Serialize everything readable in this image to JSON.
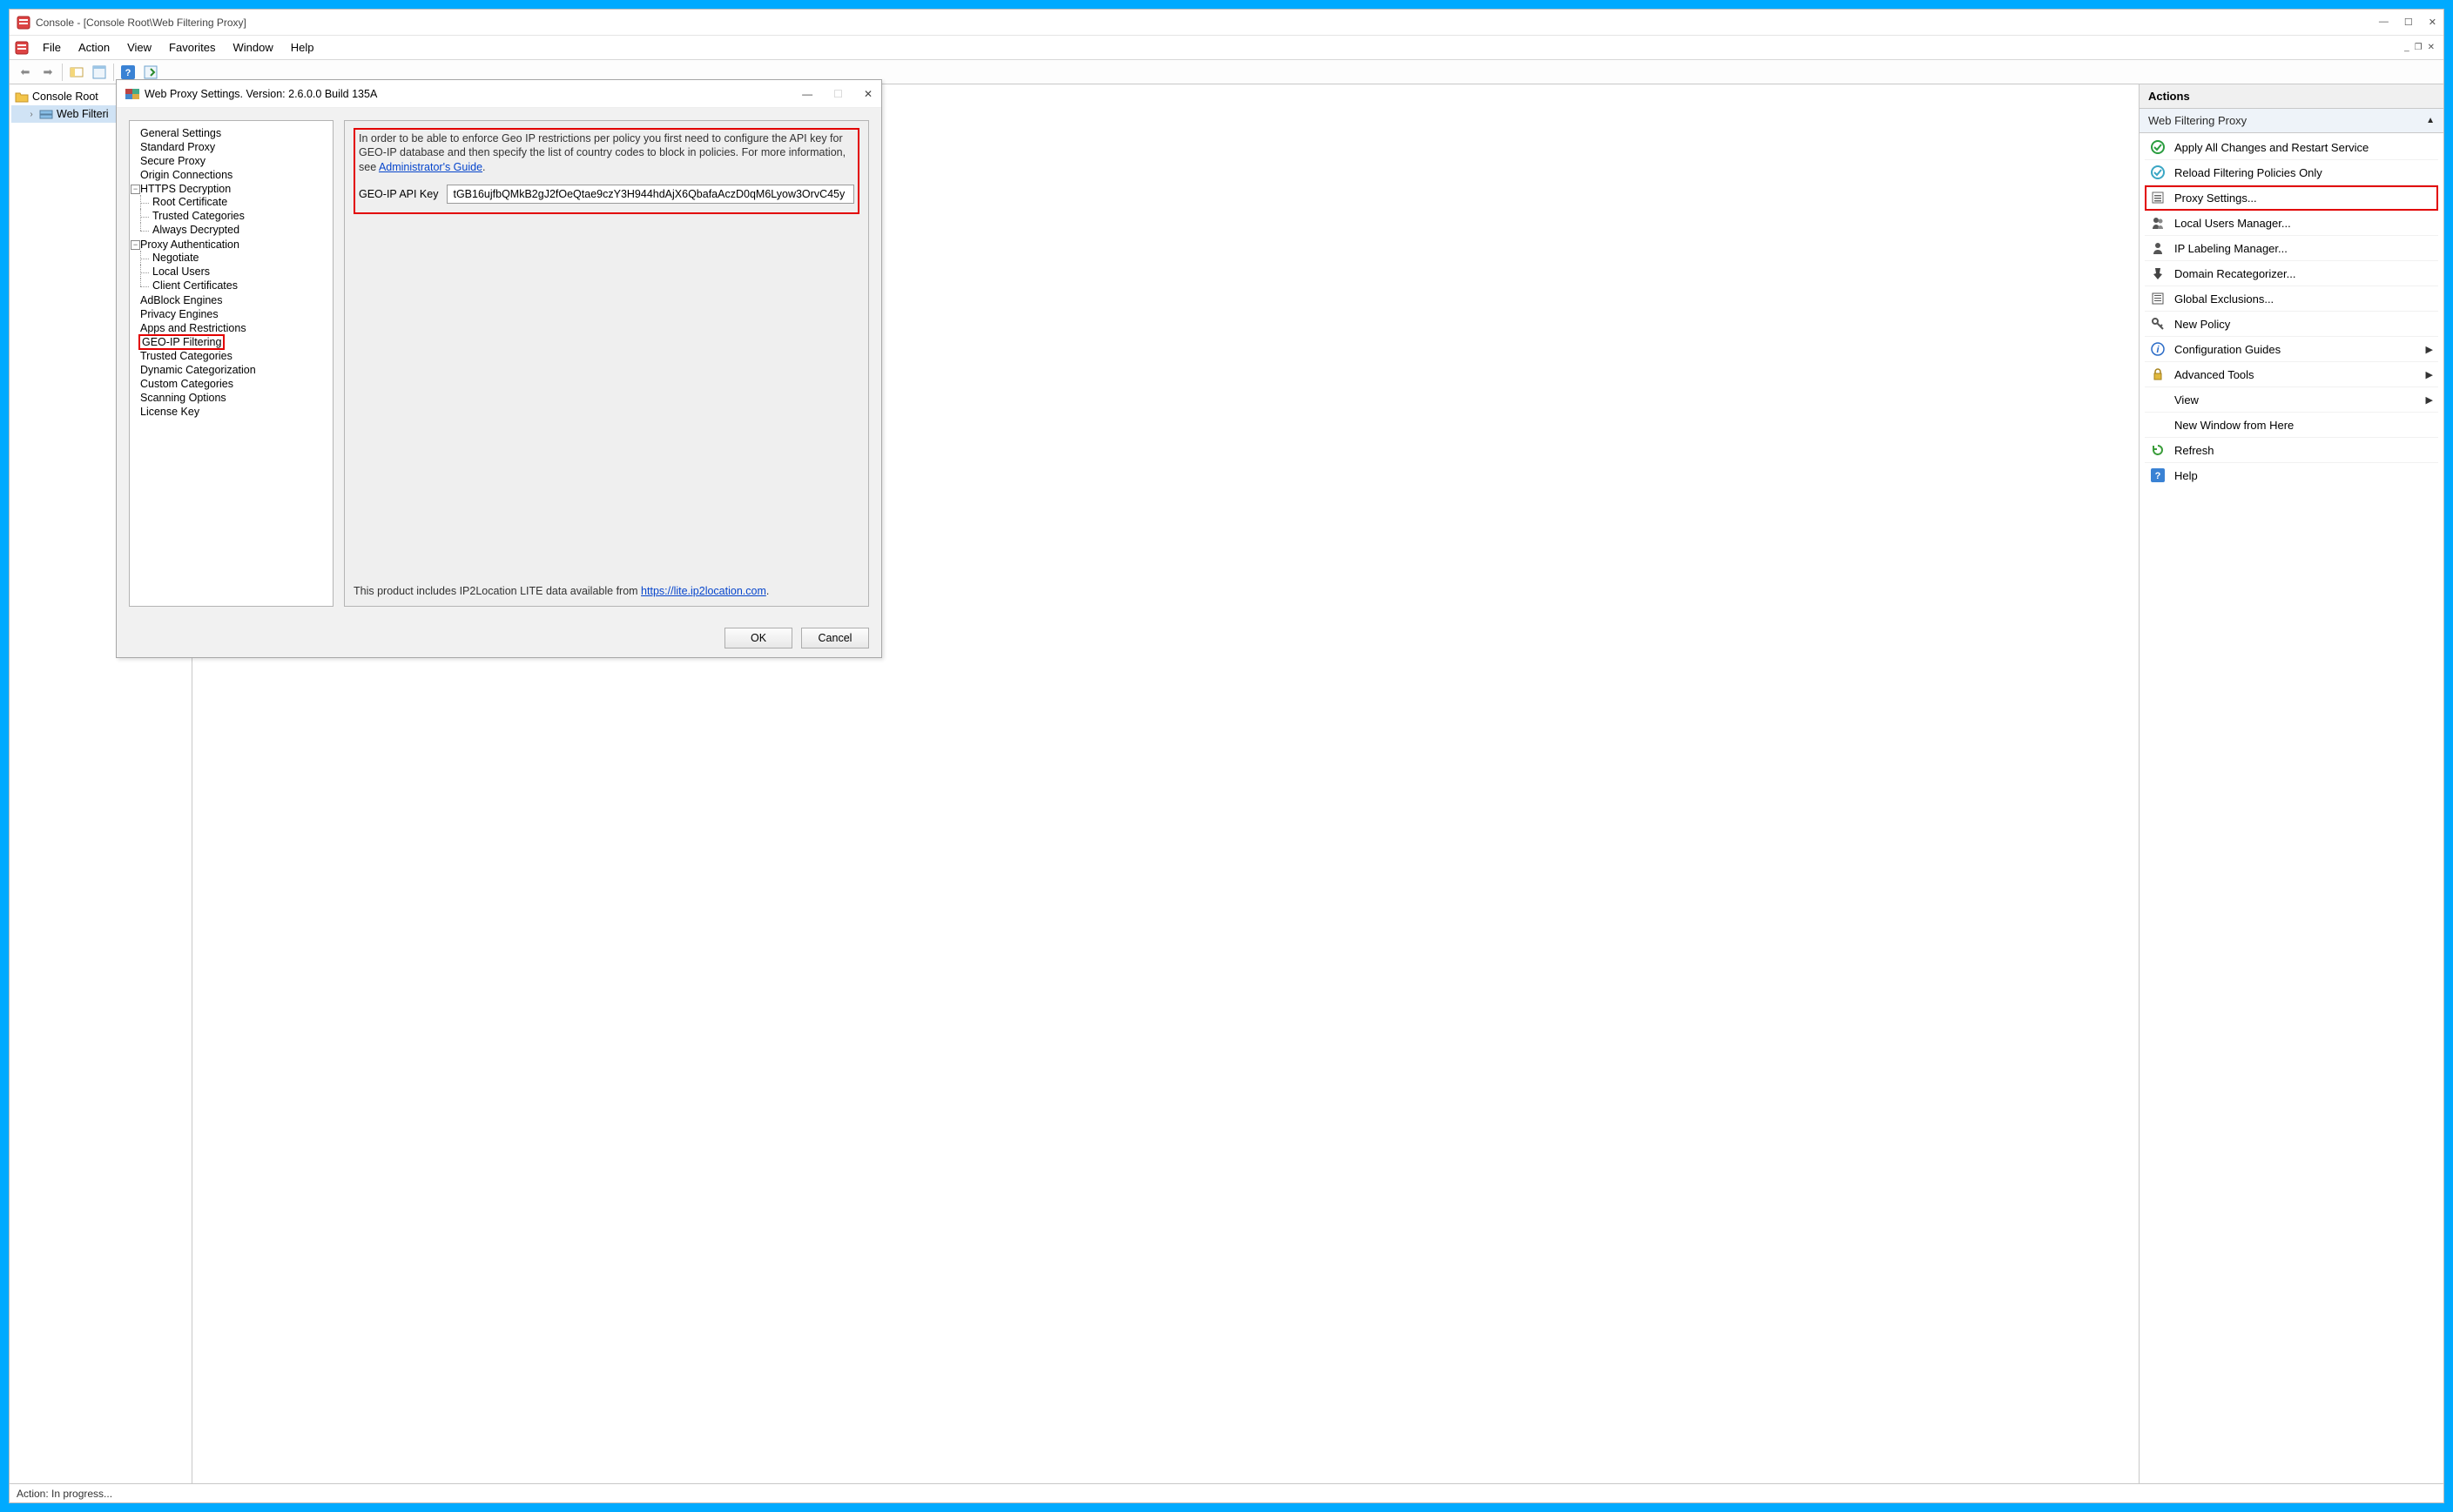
{
  "window": {
    "title": "Console - [Console Root\\Web Filtering Proxy]"
  },
  "menu": {
    "file": "File",
    "action": "Action",
    "view": "View",
    "favorites": "Favorites",
    "window": "Window",
    "help": "Help"
  },
  "tree": {
    "root": "Console Root",
    "child": "Web Filteri"
  },
  "actions": {
    "header": "Actions",
    "group": "Web Filtering Proxy",
    "apply": "Apply All Changes and Restart Service",
    "reload": "Reload Filtering Policies Only",
    "proxy_settings": "Proxy Settings...",
    "local_users": "Local Users Manager...",
    "ip_labeling": "IP Labeling Manager...",
    "domain_recat": "Domain Recategorizer...",
    "global_excl": "Global Exclusions...",
    "new_policy": "New Policy",
    "config_guides": "Configuration Guides",
    "advanced": "Advanced Tools",
    "view": "View",
    "new_window": "New Window from Here",
    "refresh": "Refresh",
    "help": "Help"
  },
  "status": {
    "text": "Action:  In progress..."
  },
  "dialog": {
    "title": "Web Proxy Settings. Version: 2.6.0.0 Build 135A",
    "info_text_1": "In order to be able to enforce Geo IP restrictions per policy you first need to configure the API key for GEO-IP database and then specify the list of country codes to block in policies. For more information, see ",
    "info_link": "Administrator's Guide",
    "info_text_2": ".",
    "key_label": "GEO-IP API Key",
    "key_value": "tGB16ujfbQMkB2gJ2fOeQtae9czY3H944hdAjX6QbafaAczD0qM6Lyow3OrvC45y",
    "footer_text": "This product includes IP2Location LITE data available from ",
    "footer_link": "https://lite.ip2location.com",
    "footer_text_2": ".",
    "ok": "OK",
    "cancel": "Cancel",
    "tree": {
      "general": "General Settings",
      "standard_proxy": "Standard Proxy",
      "secure_proxy": "Secure Proxy",
      "origin_conn": "Origin Connections",
      "https_decrypt": "HTTPS Decryption",
      "root_cert": "Root Certificate",
      "trusted_cat": "Trusted Categories",
      "always_decrypt": "Always Decrypted",
      "proxy_auth": "Proxy Authentication",
      "negotiate": "Negotiate",
      "local_users": "Local Users",
      "client_certs": "Client Certificates",
      "adblock": "AdBlock Engines",
      "privacy": "Privacy Engines",
      "apps_restrict": "Apps and Restrictions",
      "geo_ip": "GEO-IP Filtering",
      "trusted_cat2": "Trusted Categories",
      "dyn_cat": "Dynamic Categorization",
      "custom_cat": "Custom Categories",
      "scan_opt": "Scanning Options",
      "license": "License Key"
    }
  }
}
